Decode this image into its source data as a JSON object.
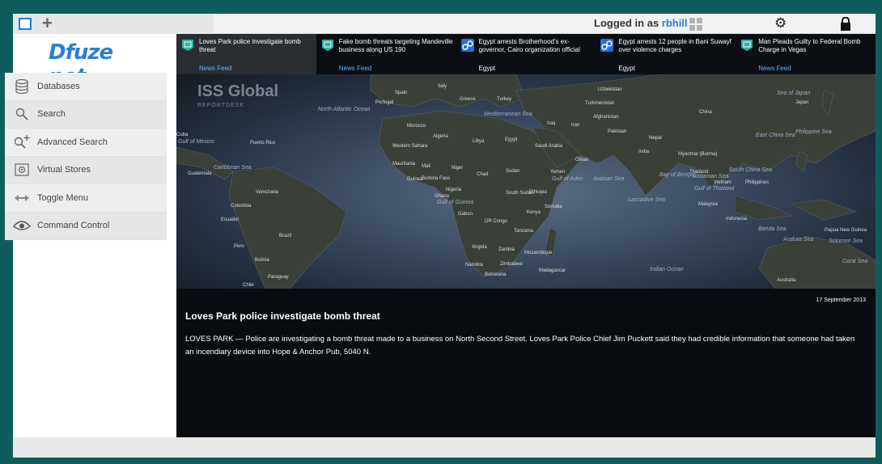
{
  "topbar": {
    "logged_in_prefix": "Logged in as ",
    "username": "rbhill"
  },
  "brand": {
    "logo_text": "Dfuze net"
  },
  "menu": [
    {
      "label": "Databases",
      "icon": "database-icon"
    },
    {
      "label": "Search",
      "icon": "search-icon"
    },
    {
      "label": "Advanced Search",
      "icon": "advanced-search-icon"
    },
    {
      "label": "Virtual Stores",
      "icon": "virtual-stores-icon"
    },
    {
      "label": "Toggle Menu",
      "icon": "toggle-arrows-icon"
    },
    {
      "label": "Command Control",
      "icon": "eye-icon"
    }
  ],
  "feeds": [
    {
      "title": "Loves Park police investigate bomb threat",
      "category": "News Feed",
      "icon": "news-feed-icon",
      "color": "#2fb3a6"
    },
    {
      "title": "Fake bomb threats targeting Mandeville business along US 190",
      "category": "News Feed",
      "icon": "news-feed-icon",
      "color": "#2fb3a6"
    },
    {
      "title": "Egypt arrests Brotherhood's ex-governor, Cairo organization official",
      "category": "Egypt",
      "icon": "handcuffs-icon",
      "color": "#2a6fd4"
    },
    {
      "title": "Egypt arrests 12 people in Bani Suwayf over violence charges",
      "category": "Egypt",
      "icon": "handcuffs-icon",
      "color": "#2a6fd4"
    },
    {
      "title": "Man Pleads Guilty to Federal Bomb Charge in Vegas",
      "category": "News Feed",
      "icon": "news-feed-icon",
      "color": "#2fb3a6"
    }
  ],
  "map": {
    "logo_main": "ISS Global",
    "logo_sub": "REPORTDESK",
    "labels": [
      "Spain",
      "Portugal",
      "Italy",
      "Greece",
      "Turkey",
      "Uzbekistan",
      "Turkmenistan",
      "Afghanistan",
      "China",
      "Japan",
      "Morocco",
      "Algeria",
      "Libya",
      "Egypt",
      "Saudi Arabia",
      "Iran",
      "Iraq",
      "Pakistan",
      "India",
      "Mali",
      "Niger",
      "Chad",
      "Sudan",
      "Yemen",
      "Ethiopia",
      "Somalia",
      "Kenya",
      "Nigeria",
      "Mauritania",
      "Western Sahara",
      "DR Congo",
      "Tanzania",
      "Angola",
      "Zambia",
      "Mozambique",
      "Namibia",
      "Zimbabwe",
      "Botswana",
      "Madagascar",
      "Brazil",
      "Peru",
      "Bolivia",
      "Paraguay",
      "Chile",
      "Colombia",
      "Venezuela",
      "Ecuador",
      "Cuba",
      "Guatemala",
      "Myanmar (Burma)",
      "Thailand",
      "Vietnam",
      "Philippines",
      "Malaysia",
      "Indonesia",
      "Papua New Guinea",
      "Australia",
      "Nepal",
      "Oman",
      "Gabon",
      "South Sudan",
      "Burkina Faso",
      "Ghana",
      "Guinea",
      "Puerto Rico"
    ],
    "oceans": [
      "North Atlantic Ocean",
      "Indian Ocean",
      "Arabian Sea",
      "Bay of Bengal",
      "South China Sea",
      "Sea of Japan",
      "Philippine Sea",
      "Coral Sea",
      "Caribbean Sea",
      "Gulf of Guinea",
      "Gulf of Aden",
      "Laccadive Sea",
      "Andaman Sea",
      "Gulf of Thailand",
      "Mediterranean Sea",
      "Banda Sea",
      "Arafura Sea",
      "Solomon Sea",
      "Gulf of Mexico",
      "East China Sea"
    ]
  },
  "article": {
    "date": "17 September 2013",
    "title": "Loves Park police investigate bomb threat",
    "body": "LOVES PARK — Police are investigating a bomb threat made to a business on North Second Street. Loves Park Police Chief Jim Puckett said they had credible information that someone had taken an incendiary device into Hope & Anchor Pub, 5040 N."
  }
}
